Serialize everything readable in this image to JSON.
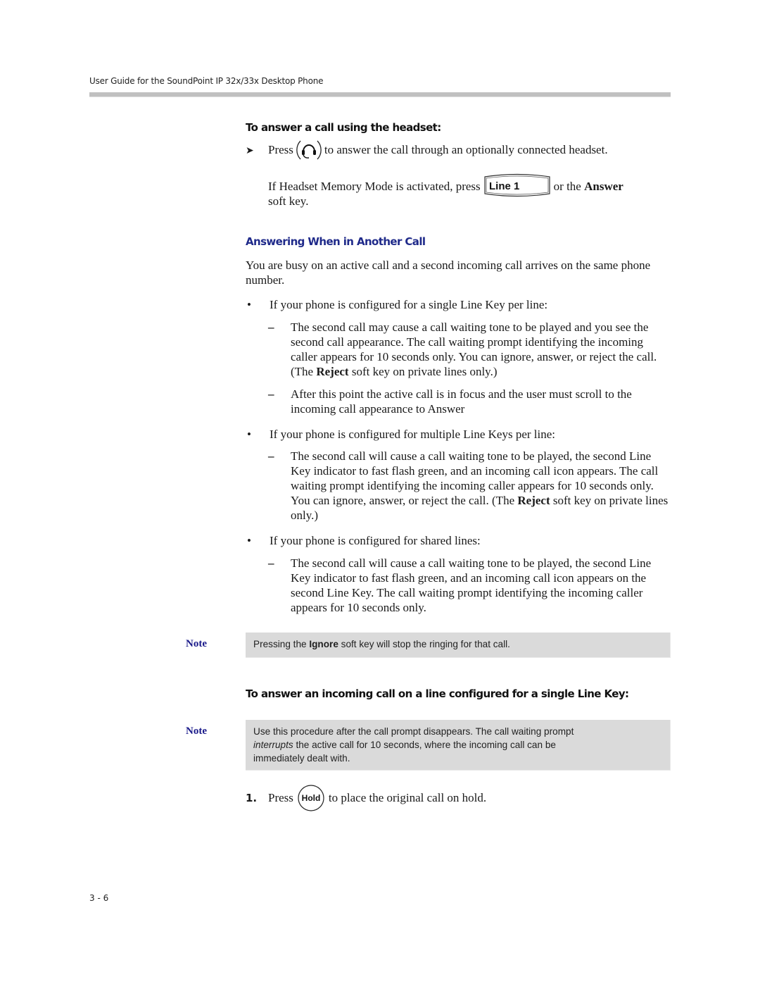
{
  "header": {
    "title": "User Guide for the SoundPoint IP 32x/33x Desktop Phone"
  },
  "headset_procedure": {
    "title": "To answer a call using the headset:",
    "bullet_icon": "arrow-bullet-icon",
    "step_press": "Press",
    "step_icon": "headset-key-icon",
    "step_rest": "to answer the call through an optionally connected headset.",
    "memory_pre": "If Headset Memory Mode is activated, press",
    "memory_key_label": "Line 1",
    "memory_or": "or the",
    "memory_bold": "Answer",
    "memory_post": "soft key."
  },
  "section": {
    "title": "Answering When in Another Call",
    "intro": "You are busy on an active call and a second incoming call arrives on the same phone number.",
    "bullets": [
      {
        "text": "If your phone is configured for a single Line Key per line:",
        "items": [
          {
            "pre": "The second call may cause a call waiting tone to be played and you see the second call appearance. The call waiting prompt identifying the incoming caller appears for 10 seconds only. You can ignore, answer, or reject the call. (The ",
            "bold": "Reject",
            "post": " soft key on private lines only.)"
          },
          {
            "pre": "After this point the active call is in focus and the user must scroll to the incoming call appearance to Answer",
            "bold": "",
            "post": ""
          }
        ]
      },
      {
        "text": "If your phone is configured for multiple Line Keys per line:",
        "items": [
          {
            "pre": "The second call will cause a call waiting tone to be played, the second Line Key indicator to fast flash green, and an incoming call icon appears. The call waiting prompt identifying the incoming caller appears for 10 seconds only. You can ignore, answer, or reject the call. (The ",
            "bold": "Reject",
            "post": " soft key on private lines only.)"
          }
        ]
      },
      {
        "text": "If your phone is configured for shared lines:",
        "items": [
          {
            "pre": "The second call will cause a call waiting tone to be played, the second Line Key indicator to fast flash green, and an incoming call icon appears on the second Line Key. The call waiting prompt identifying the incoming caller appears for 10 seconds only.",
            "bold": "",
            "post": ""
          }
        ]
      }
    ]
  },
  "note1": {
    "label": "Note",
    "pre": "Pressing the ",
    "bold": "Ignore",
    "post": " soft key will stop the ringing for that call."
  },
  "single_key_procedure": {
    "title": "To answer an incoming call on a line configured for a single Line Key:"
  },
  "note2": {
    "label": "Note",
    "line1": "Use this procedure after the call prompt disappears. The call waiting prompt",
    "italic": "interrupts",
    "line2_rest": " the active call for 10 seconds, where the incoming call can be",
    "line3": "immediately dealt with."
  },
  "steps": [
    {
      "number": "1.",
      "press": "Press",
      "key_label": "Hold",
      "rest": "to place the original call on hold."
    }
  ],
  "footer": {
    "page_number": "3 - 6"
  }
}
